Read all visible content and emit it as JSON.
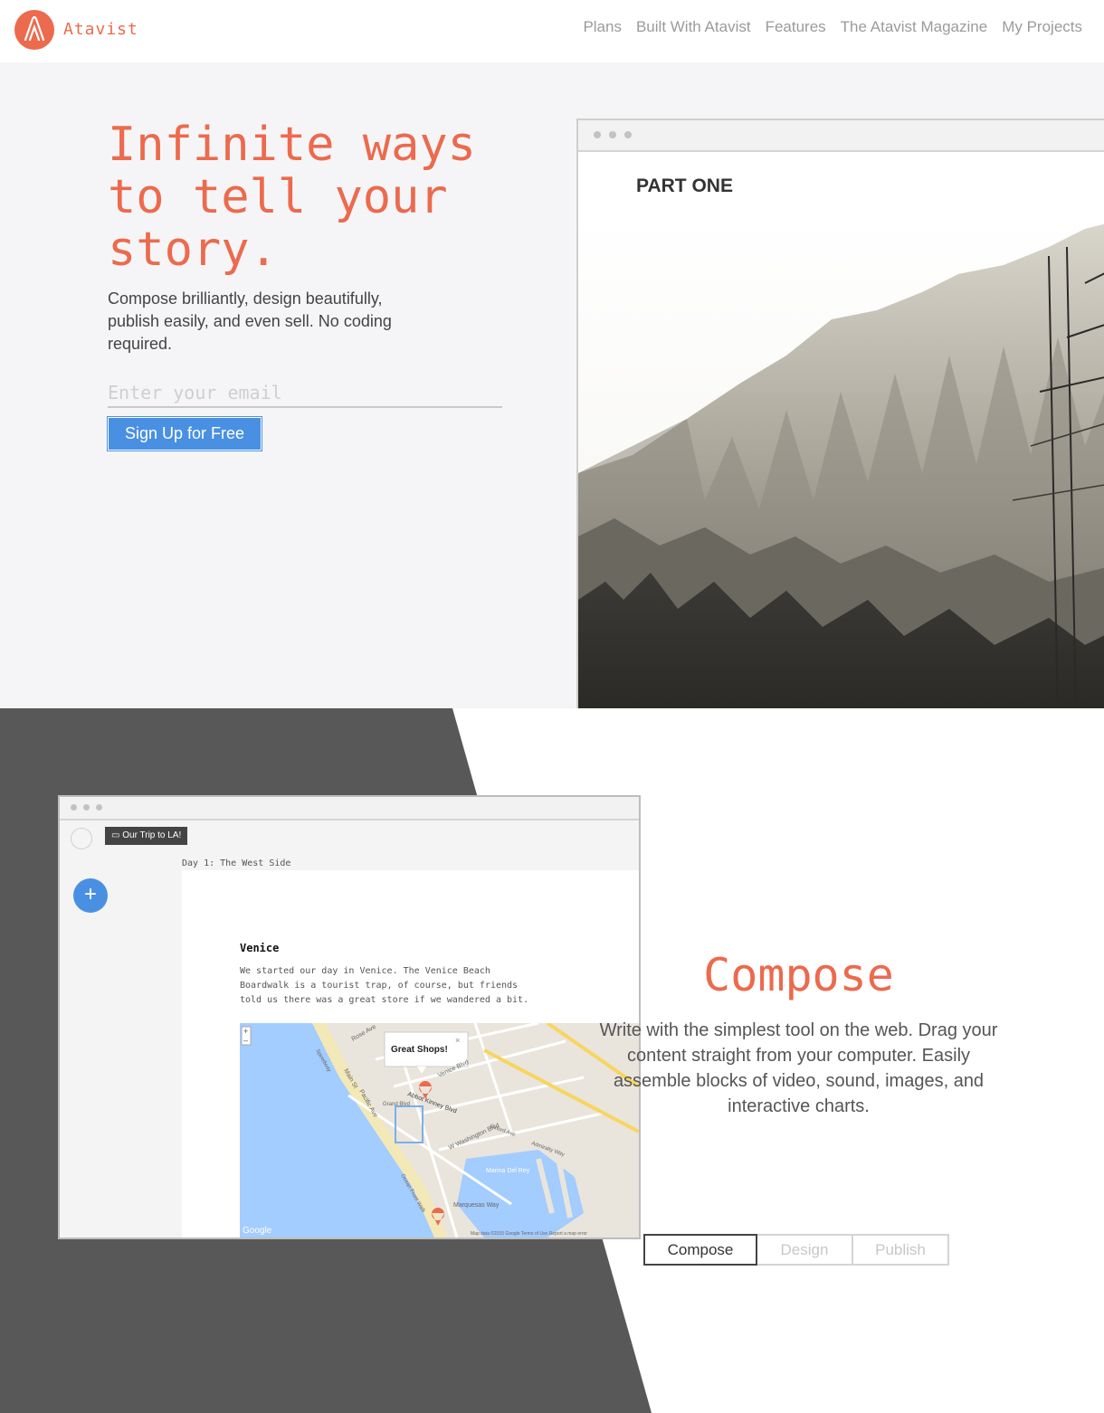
{
  "brand": {
    "name": "Atavist",
    "color": "#ec6a4d"
  },
  "nav": [
    "Plans",
    "Built With Atavist",
    "Features",
    "The Atavist Magazine",
    "My Projects"
  ],
  "hero": {
    "title": "Infinite ways to tell your story.",
    "subtitle": "Compose brilliantly, design beautifully, publish easily, and even sell. No coding required.",
    "email_placeholder": "Enter your email",
    "signup_label": "Sign Up for Free"
  },
  "preview": {
    "heading": "PART ONE"
  },
  "editor": {
    "project_tag": "Our Trip to LA!",
    "section_label": "Day 1: The West Side",
    "block_title": "Venice",
    "block_text": "We started our day in Venice. The Venice Beach Boardwalk is a tourist trap, of course, but friends told us there was a great store if we wandered a bit.",
    "map_popup": "Great Shops!",
    "map_footer": "Map data ©2015 Google  Terms of Use  Report a map error",
    "map_brand": "Google",
    "map_labels": [
      "Rose Ave",
      "Main St",
      "Pacific Ave",
      "Abbot Kinney Blvd",
      "Venice Blvd",
      "W Washington Blvd",
      "Marina Del Rey",
      "Marquesas Way",
      "Grand Blvd",
      "Speedway",
      "Ocean Front Walk",
      "Oxford Ave",
      "Admiralty Way"
    ]
  },
  "compose": {
    "title": "Compose",
    "description": "Write with the simplest tool on the web. Drag your content straight from your computer. Easily assemble blocks of video, sound, images, and interactive charts.",
    "tabs": [
      {
        "label": "Compose",
        "active": true
      },
      {
        "label": "Design",
        "active": false
      },
      {
        "label": "Publish",
        "active": false
      }
    ]
  },
  "colors": {
    "accent": "#ec6a4d",
    "button": "#4a90e2",
    "dark_panel": "#585858",
    "hero_bg": "#f5f5f7"
  }
}
